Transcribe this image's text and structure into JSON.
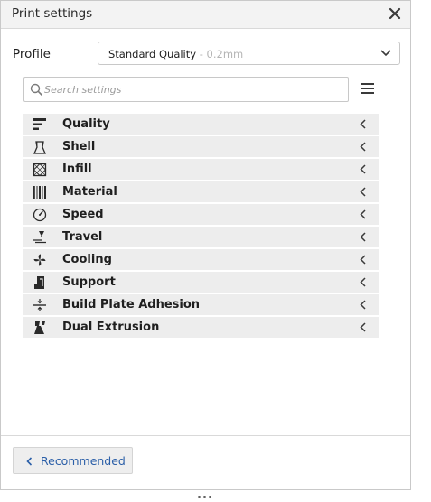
{
  "header": {
    "title": "Print settings",
    "close_icon": "close-icon"
  },
  "profile": {
    "label": "Profile",
    "name": "Standard Quality",
    "layer_height": " - 0.2mm"
  },
  "search": {
    "placeholder": "Search settings"
  },
  "categories": [
    {
      "label": "Quality",
      "icon": "quality-icon"
    },
    {
      "label": "Shell",
      "icon": "shell-icon"
    },
    {
      "label": "Infill",
      "icon": "infill-icon"
    },
    {
      "label": "Material",
      "icon": "material-icon"
    },
    {
      "label": "Speed",
      "icon": "speed-icon"
    },
    {
      "label": "Travel",
      "icon": "travel-icon"
    },
    {
      "label": "Cooling",
      "icon": "cooling-icon"
    },
    {
      "label": "Support",
      "icon": "support-icon"
    },
    {
      "label": "Build Plate Adhesion",
      "icon": "build-plate-adhesion-icon"
    },
    {
      "label": "Dual Extrusion",
      "icon": "dual-extrusion-icon"
    }
  ],
  "footer": {
    "recommended_label": "Recommended"
  },
  "colors": {
    "accent": "#2b5fa8",
    "header_bg": "#f3f3f3",
    "row_bg": "#ededed"
  }
}
